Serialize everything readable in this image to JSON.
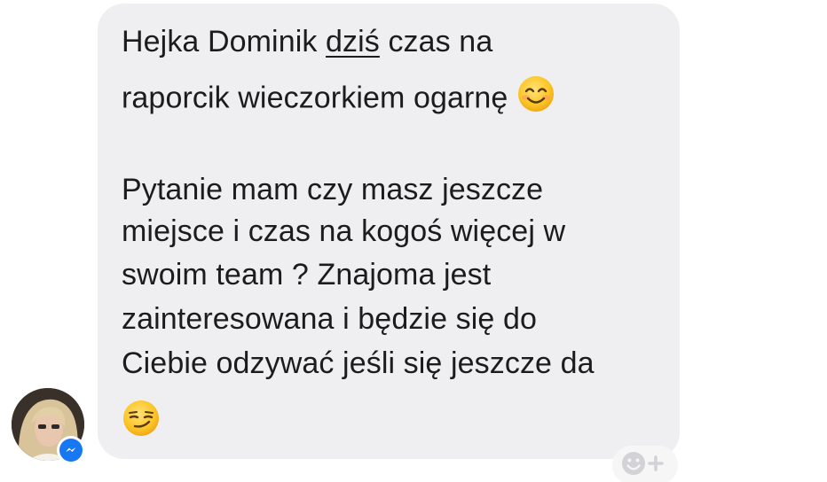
{
  "message": {
    "line1_before": "Hejka Dominik ",
    "line1_underlined": "dziś",
    "line1_after": " czas  na",
    "line2": "raporcik wieczorkiem ogarnę ",
    "line2_emoji": "smiling-face-icon",
    "line3": "Pytanie mam czy masz jeszcze",
    "line4": "miejsce i czas na kogoś więcej w",
    "line5": "swoim team ? Znajoma jest",
    "line6": "zainteresowana i  będzie się do",
    "line7": "Ciebie odzywać jeśli się jeszcze da",
    "line8_emoji": "smirking-face-icon"
  },
  "sender": {
    "avatar_icon": "avatar",
    "badge_icon": "messenger-icon",
    "badge_color": "#1877f2"
  },
  "reaction": {
    "icon": "add-reaction-icon"
  },
  "colors": {
    "bubble": "#efeff1",
    "text": "#1c1c1e"
  }
}
